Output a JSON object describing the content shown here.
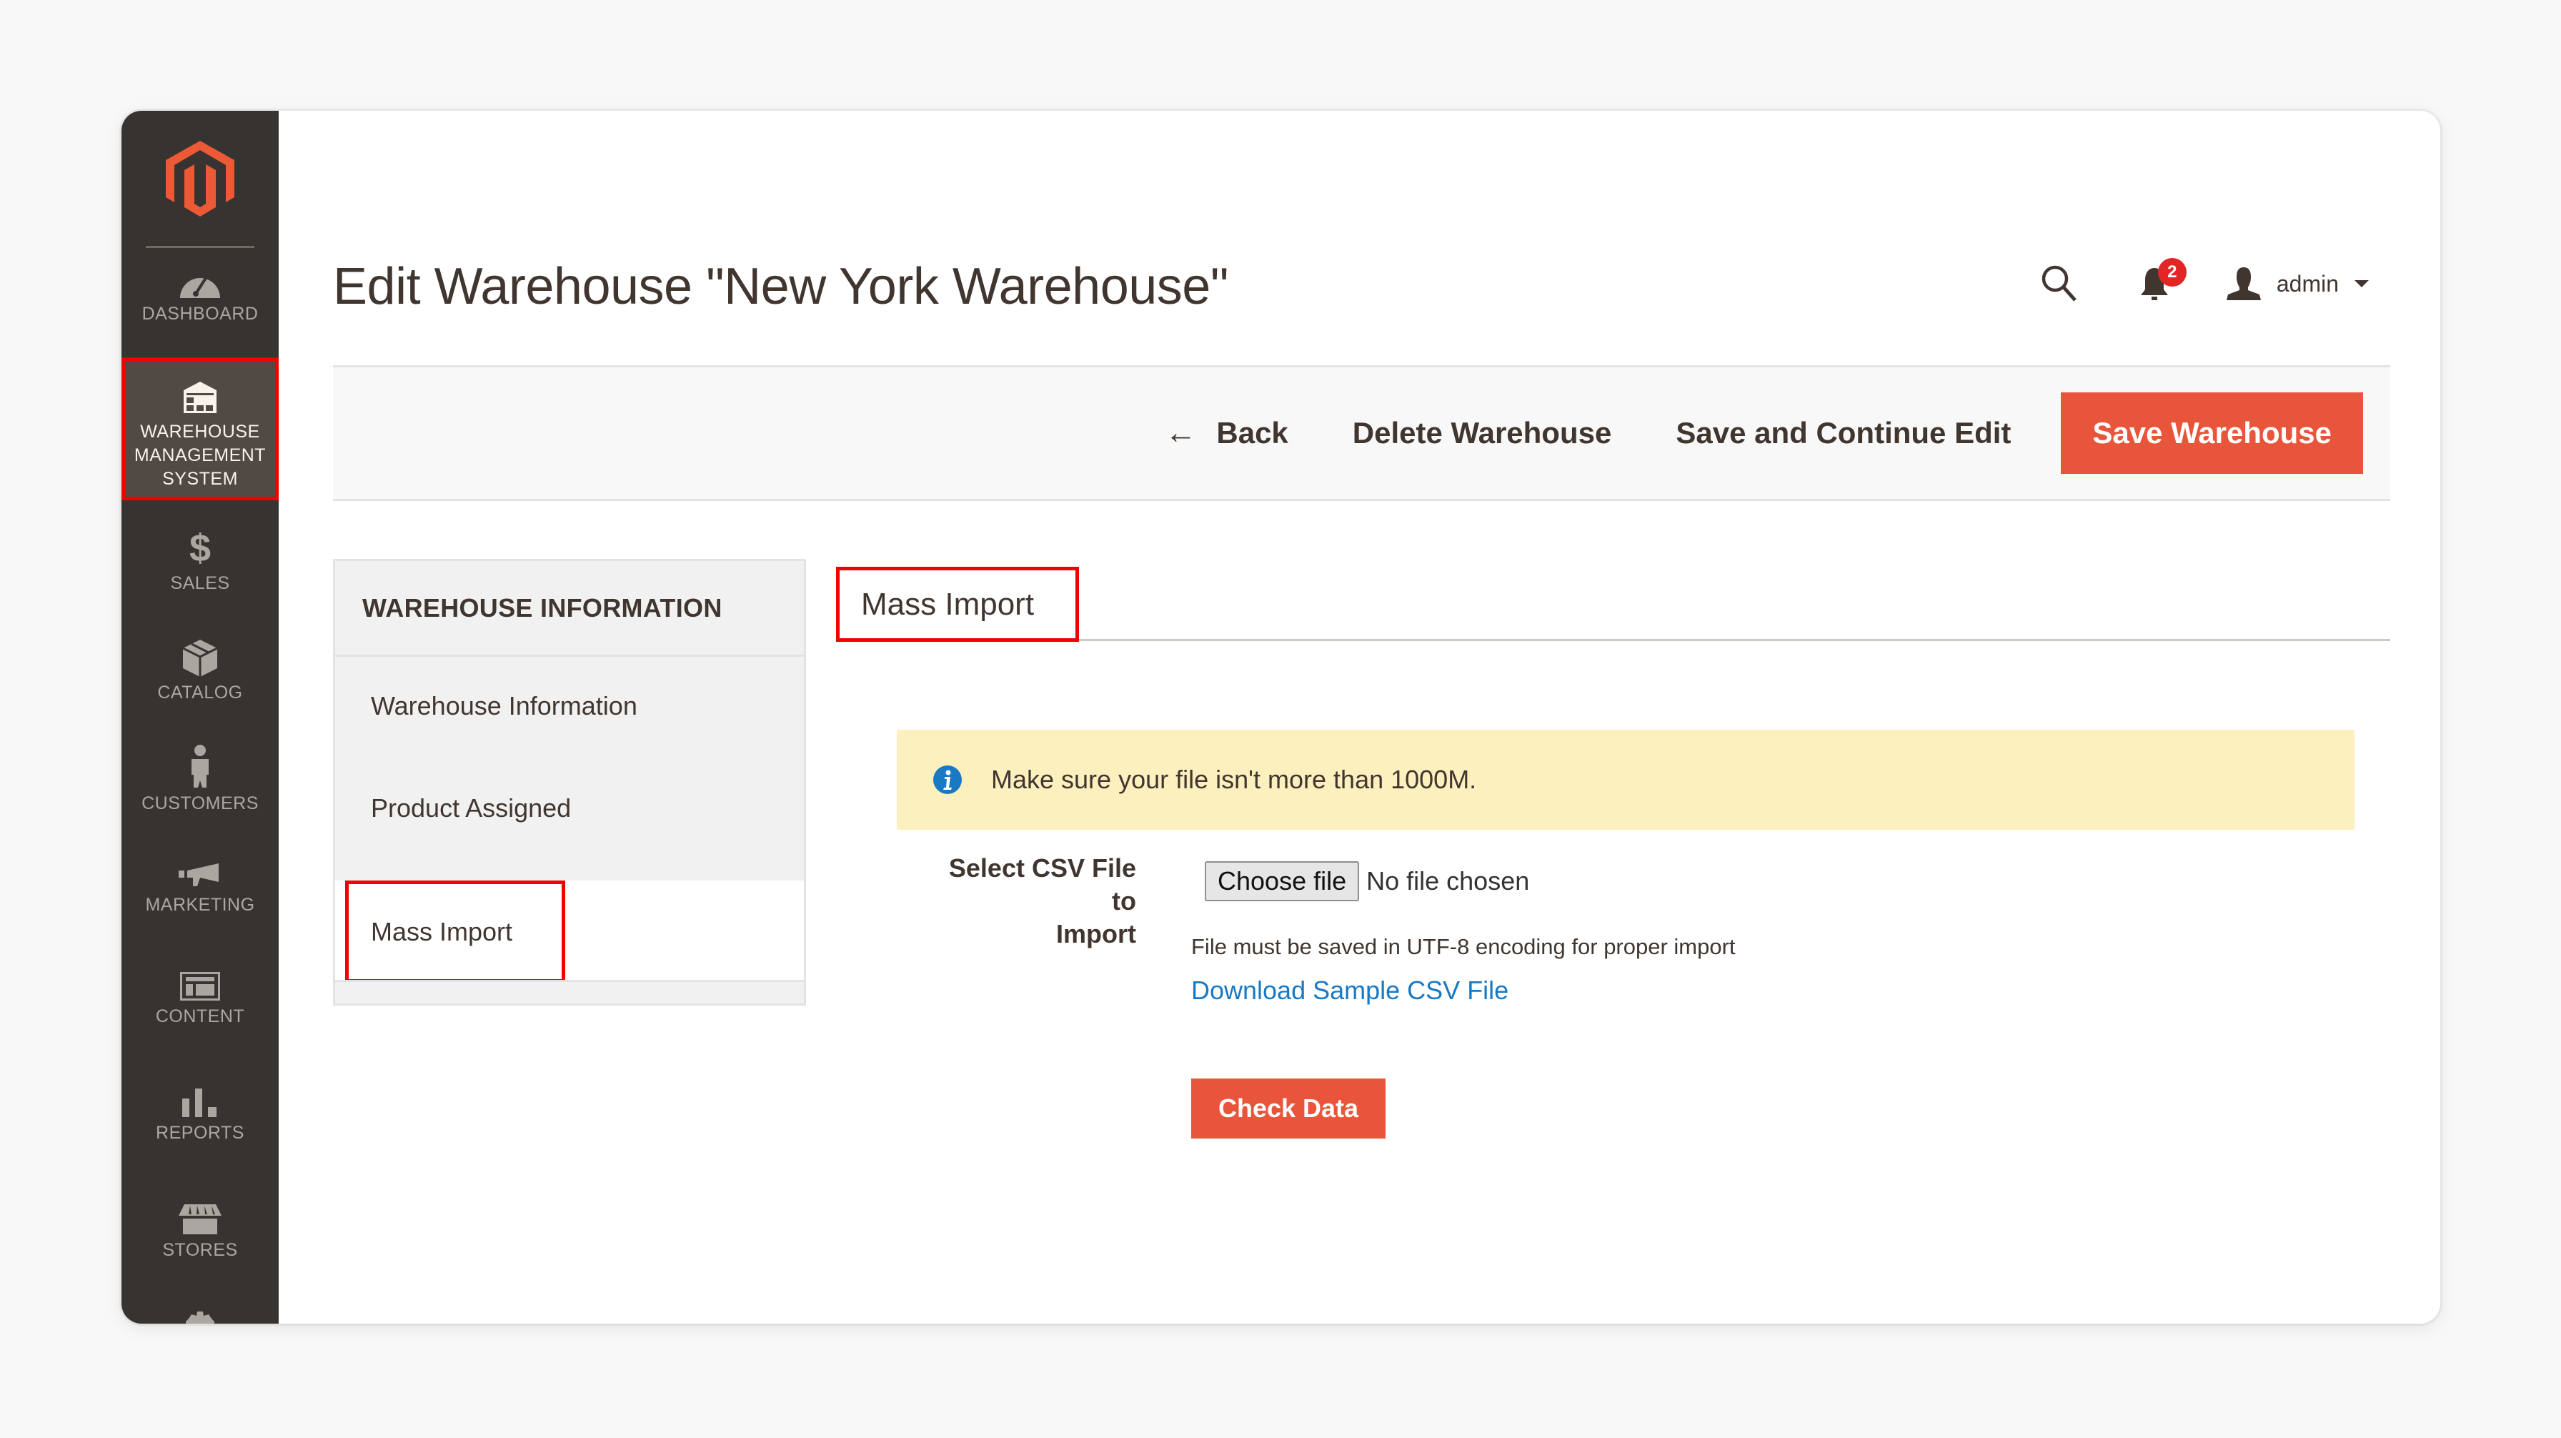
{
  "sidebar": {
    "logo": "magento-logo",
    "items": [
      {
        "label": "DASHBOARD",
        "icon": "dashboard-gauge-icon"
      },
      {
        "label": "WAREHOUSE MANAGEMENT SYSTEM",
        "line1": "WAREHOUSE",
        "line2": "MANAGEMENT",
        "line3": "SYSTEM",
        "icon": "warehouse-icon",
        "active": true
      },
      {
        "label": "SALES",
        "icon": "dollar-icon"
      },
      {
        "label": "CATALOG",
        "icon": "box-icon"
      },
      {
        "label": "CUSTOMERS",
        "icon": "person-icon"
      },
      {
        "label": "MARKETING",
        "icon": "megaphone-icon"
      },
      {
        "label": "CONTENT",
        "icon": "layout-icon"
      },
      {
        "label": "REPORTS",
        "icon": "bar-chart-icon"
      },
      {
        "label": "STORES",
        "icon": "storefront-icon"
      }
    ]
  },
  "header": {
    "title": "Edit Warehouse \"New York Warehouse\"",
    "notifications_count": "2",
    "user_name": "admin"
  },
  "toolbar": {
    "back_label": "Back",
    "back_arrow": "←",
    "delete_label": "Delete Warehouse",
    "save_continue_label": "Save and Continue Edit",
    "save_label": "Save Warehouse"
  },
  "tabs": {
    "title": "WAREHOUSE INFORMATION",
    "items": [
      {
        "label": "Warehouse Information"
      },
      {
        "label": "Product Assigned"
      },
      {
        "label": "Mass Import",
        "active": true
      }
    ]
  },
  "content": {
    "section_title": "Mass Import",
    "notice": "Make sure your file isn't more than 1000M.",
    "field_label_line1": "Select CSV File to",
    "field_label_line2": "Import",
    "file_button": "Choose file",
    "file_status": "No file chosen",
    "note": "File must be saved in UTF-8 encoding for proper import",
    "download_link": "Download Sample CSV File",
    "check_button": "Check Data"
  },
  "colors": {
    "sidebar_bg": "#373330",
    "sidebar_active_bg": "#514943",
    "accent_orange": "#e9553a",
    "highlight_red": "#f20000",
    "notice_bg": "#fdf0bf",
    "link_blue": "#1979c3",
    "badge_red": "#e22626"
  }
}
